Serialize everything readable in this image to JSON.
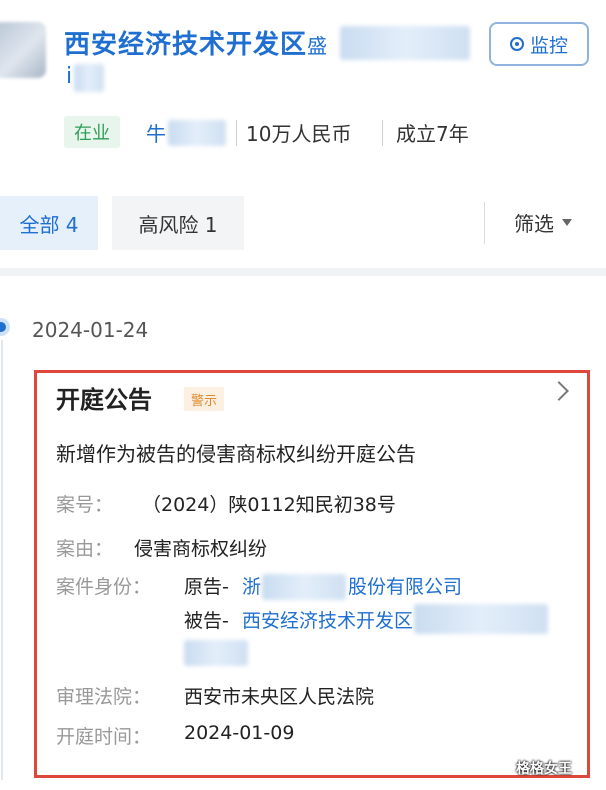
{
  "header": {
    "company_name": "西安经济技术开发区",
    "company_name_tail": "i",
    "monitor_label": "监控",
    "status": "在业",
    "legal_rep": "牛",
    "capital": "10万人民币",
    "founded": "成立7年"
  },
  "tabs": {
    "all": "全部 4",
    "high_risk": "高风险 1",
    "filter": "筛选"
  },
  "entry": {
    "date": "2024-01-24",
    "card": {
      "title": "开庭公告",
      "badge": "警示",
      "headline": "新增作为被告的侵害商标权纠纷开庭公告",
      "case_no_label": "案号：",
      "case_no": "（2024）陕0112知民初38号",
      "cause_label": "案由：",
      "cause": "侵害商标权纠纷",
      "identity_label": "案件身份：",
      "plaintiff_prefix": "原告-",
      "plaintiff_start": "浙",
      "plaintiff_end": "股份有限公司",
      "defendant_prefix": "被告-",
      "defendant_name": "西安经济技术开发区",
      "court_label": "审理法院：",
      "court": "西安市未央区人民法院",
      "hearing_label": "开庭时间：",
      "hearing_date": "2024-01-09"
    }
  },
  "watermark": "格格女王",
  "colors": {
    "accent": "#1f6fd1",
    "highlight_border": "#e0473b",
    "status_green": "#2f9e58",
    "warning": "#e38b2e"
  }
}
